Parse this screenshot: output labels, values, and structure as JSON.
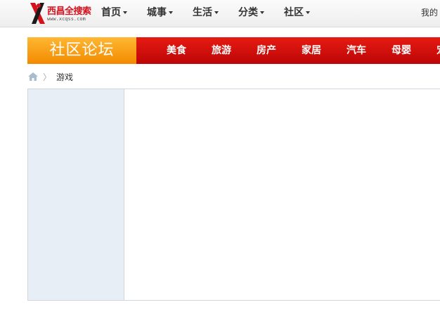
{
  "logo": {
    "text": "西昌全搜索",
    "url": "www.xcqss.com",
    "icon": "xc-logo-icon"
  },
  "topnav": [
    "首页",
    "城事",
    "生活",
    "分类",
    "社区"
  ],
  "mine_label": "我的",
  "channel": {
    "title": "社区论坛",
    "items": [
      "美食",
      "旅游",
      "房产",
      "家居",
      "汽车",
      "母婴",
      "宠物"
    ]
  },
  "breadcrumb": {
    "home_icon": "home-icon",
    "current": "游戏"
  },
  "colors": {
    "brand_red": "#d4121e",
    "channel_orange": "#f38a00",
    "sidebar": "#e8eef5"
  }
}
